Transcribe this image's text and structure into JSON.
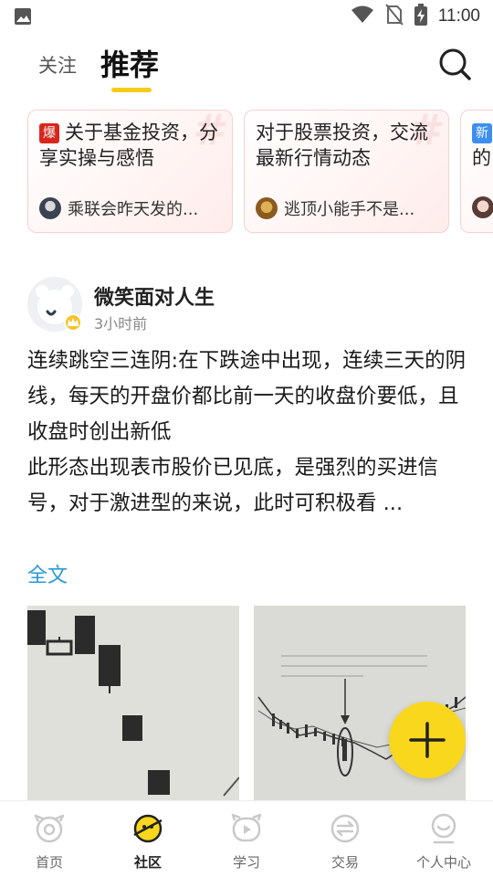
{
  "status_bar": {
    "time": "11:00",
    "icons": [
      "image-icon",
      "wifi-icon",
      "no-sim-icon",
      "battery-charging-icon"
    ]
  },
  "top_nav": {
    "tabs": [
      {
        "label": "关注",
        "active": false
      },
      {
        "label": "推荐",
        "active": true
      }
    ],
    "search_icon": "search-icon",
    "accent_color": "#f5cc1a"
  },
  "topics": [
    {
      "tag": "爆",
      "title": "关于基金投资，分享实操与感悟",
      "user_text": "乘联会昨天发的..."
    },
    {
      "tag": "",
      "title": "对于股票投资，交流最新行情动态",
      "user_text": "逃顶小能手不是..."
    },
    {
      "tag": "新",
      "title": "的",
      "user_text": ""
    }
  ],
  "post": {
    "author": "微笑面对人生",
    "time": "3小时前",
    "body_lines": [
      "连续跳空三连阴:在下跌途中出现，连续三天的阴线，每天的开盘价都比前一天的收盘价要低，且收盘时创出新低",
      "此形态出现表市股价已见底，是强烈的买进信号，对于激进型的来说，此时可积极看 ..."
    ],
    "read_more": "全文",
    "link_color": "#2a9ad9"
  },
  "fab": {
    "icon": "plus-icon",
    "color": "#f9d71c"
  },
  "bottom_nav": {
    "items": [
      {
        "label": "首页",
        "icon": "home-icon",
        "active": false
      },
      {
        "label": "社区",
        "icon": "community-icon",
        "active": true
      },
      {
        "label": "学习",
        "icon": "study-icon",
        "active": false
      },
      {
        "label": "交易",
        "icon": "trade-icon",
        "active": false
      },
      {
        "label": "个人中心",
        "icon": "profile-icon",
        "active": false
      }
    ]
  }
}
